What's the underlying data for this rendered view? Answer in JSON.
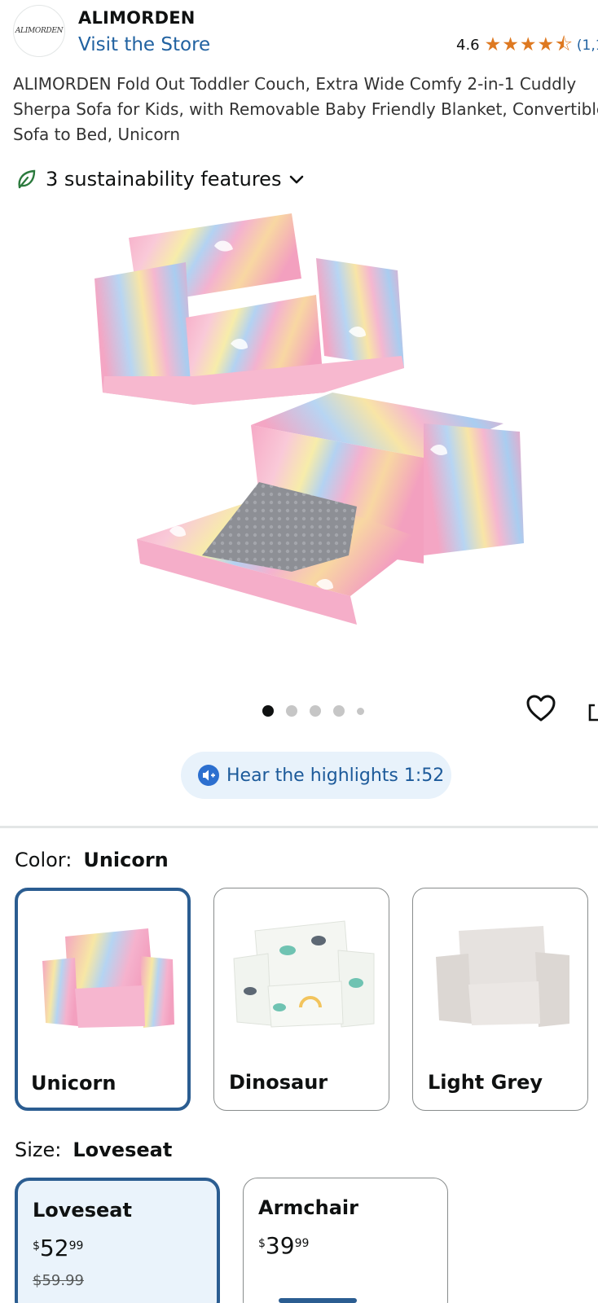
{
  "brand": {
    "logo_text": "ALIMORDEN",
    "name": "ALIMORDEN",
    "store_link": "Visit the Store"
  },
  "rating": {
    "value": "4.6",
    "stars": 4.6,
    "count": "(1,1"
  },
  "product": {
    "title": "ALIMORDEN Fold Out Toddler Couch, Extra Wide Comfy 2-in-1 Cuddly Sherpa Sofa for Kids, with Removable Baby Friendly Blanket, Convertible Sofa to Bed, Unicorn"
  },
  "sustainability": {
    "label": "3 sustainability features",
    "icon": "leaf-icon"
  },
  "gallery": {
    "image_count": 5,
    "active_index": 0
  },
  "actions": {
    "wishlist_icon": "heart-icon",
    "share_icon": "share-icon"
  },
  "highlights": {
    "label": "Hear the highlights 1:52",
    "icon": "speaker-icon"
  },
  "color": {
    "label": "Color:",
    "selected": "Unicorn",
    "options": [
      {
        "name": "Unicorn"
      },
      {
        "name": "Dinosaur"
      },
      {
        "name": "Light Grey"
      }
    ]
  },
  "size": {
    "label": "Size:",
    "selected": "Loveseat",
    "options": [
      {
        "name": "Loveseat",
        "currency": "$",
        "whole": "52",
        "fraction": "99",
        "was": "$59.99"
      },
      {
        "name": "Armchair",
        "currency": "$",
        "whole": "39",
        "fraction": "99",
        "was": ""
      }
    ]
  },
  "colors": {
    "link": "#2162a1",
    "star": "#de7921",
    "selected_border": "#2b5d91",
    "highlight_bg": "#e8f2fb"
  }
}
